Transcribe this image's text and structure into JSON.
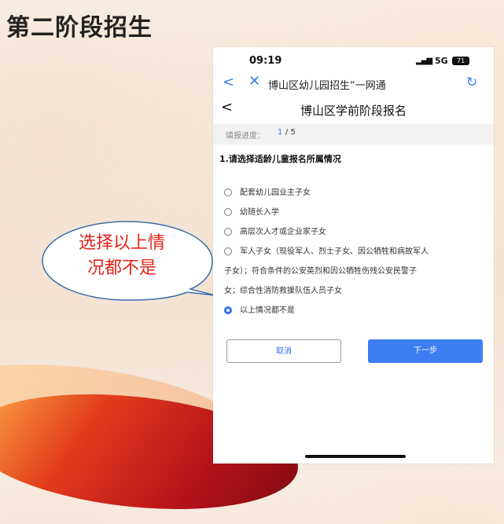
{
  "slide": {
    "title": "第二阶段招生"
  },
  "callout": {
    "line1": "选择以上情",
    "line2": "况都不是"
  },
  "phone": {
    "status": {
      "time": "09:19",
      "network": "5G",
      "battery": "71"
    },
    "browser": {
      "title": "博山区幼儿园招生“一网通",
      "back_icon": "chevron-left-icon",
      "close_icon": "close-icon",
      "refresh_icon": "refresh-icon"
    },
    "page": {
      "title": "博山区学前阶段报名",
      "progress_label": "填报进度：",
      "progress_current": "1",
      "progress_total": "/ 5",
      "question": "1.请选择适龄儿童报名所属情况",
      "options": [
        {
          "label": "配套幼儿园业主子女",
          "selected": false
        },
        {
          "label": "幼随长入学",
          "selected": false
        },
        {
          "label": "高层次人才或企业家子女",
          "selected": false
        },
        {
          "label_line1": "军人子女（现役军人、烈士子女、因公牺牲和病故军人",
          "label_line2": "子女）；符合条件的公安英烈和因公牺牲伤残公安民警子",
          "label_line3": "女；综合性消防救援队伍人员子女",
          "selected": false
        },
        {
          "label": "以上情况都不是",
          "selected": true
        }
      ],
      "cancel_label": "取消",
      "next_label": "下一步"
    }
  },
  "colors": {
    "accent": "#3d7ef2",
    "callout_text": "#e3241b",
    "callout_border": "#3a6ea8"
  }
}
